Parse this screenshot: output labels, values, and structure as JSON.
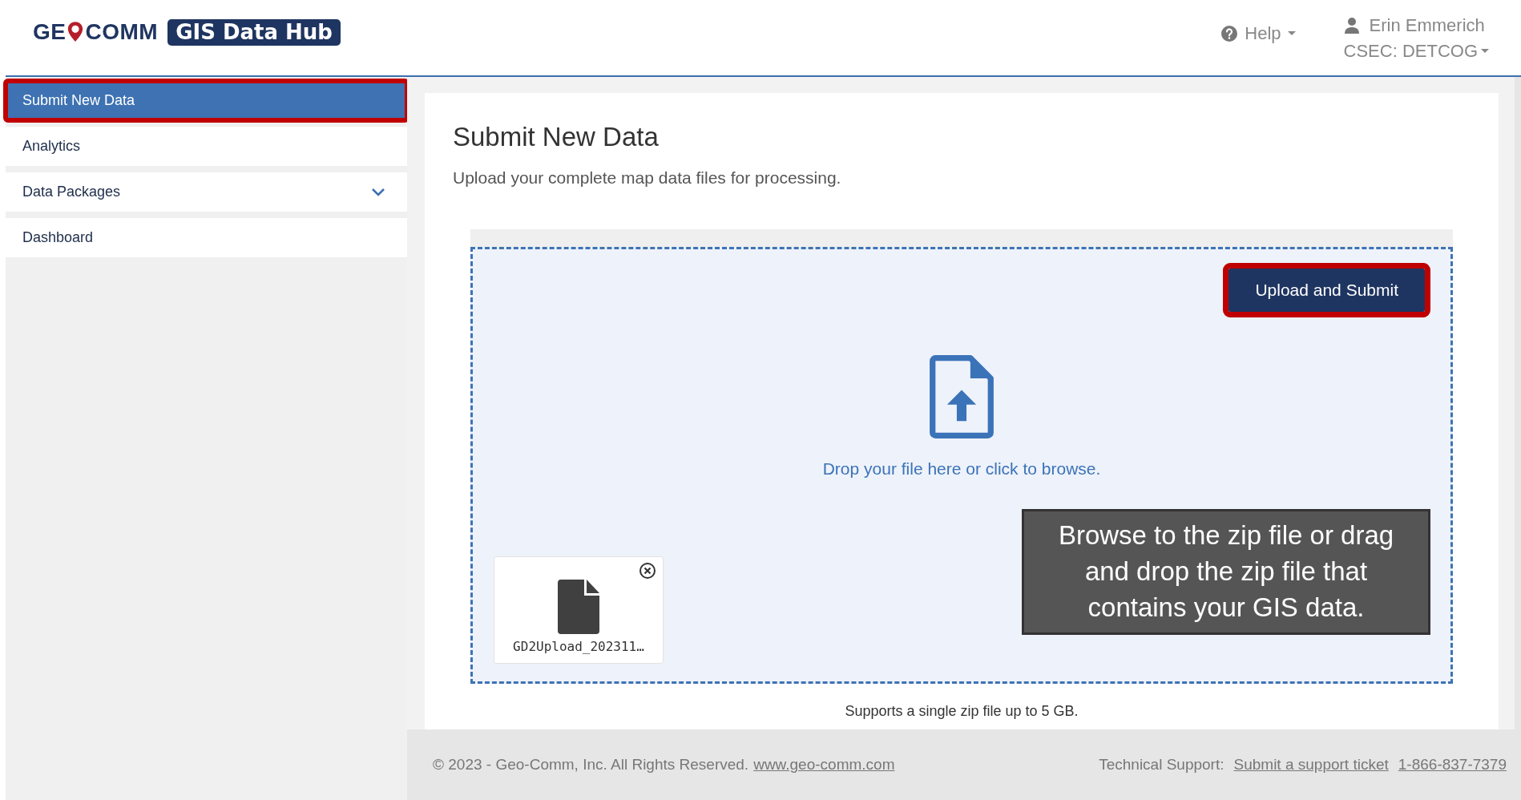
{
  "logo": {
    "wordmark_start": "GE",
    "wordmark_end": "COMM",
    "badge": "GIS Data Hub"
  },
  "header": {
    "help": "Help",
    "user": "Erin Emmerich",
    "organization": "CSEC: DETCOG"
  },
  "sidebar": {
    "items": [
      {
        "label": "Submit New Data",
        "selected": true,
        "annotated": true
      },
      {
        "label": "Analytics",
        "selected": false,
        "annotated": false
      },
      {
        "label": "Data Packages",
        "selected": false,
        "annotated": false,
        "expanded": false
      },
      {
        "label": "Dashboard",
        "selected": false,
        "annotated": false
      }
    ]
  },
  "page": {
    "title": "Submit New Data",
    "subtitle": "Upload your complete map data files for processing."
  },
  "dropzone": {
    "button": {
      "label": "Upload and Submit",
      "annotated": true
    },
    "prompt": "Drop your file here or click to browse.",
    "files": [
      {
        "name": "GD2Upload_202311…"
      }
    ],
    "callout": "Browse to the zip file or drag and drop the zip file that contains your GIS data.",
    "note": "Supports a single zip file up to 5 GB."
  },
  "footer": {
    "copyright": "© 2023 - Geo-Comm, Inc. All Rights Reserved.",
    "website": "www.geo-comm.com",
    "support_label": "Technical Support:",
    "support_link": "Submit a support ticket",
    "phone": "1-866-837-7379"
  }
}
